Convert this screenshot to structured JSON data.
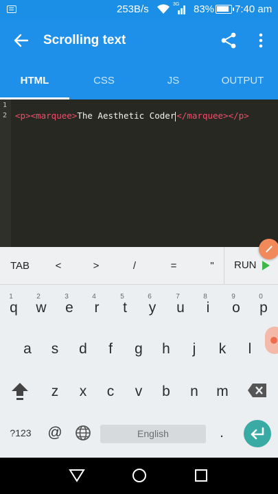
{
  "status_bar": {
    "network_speed": "253B/s",
    "signal_label": "3G",
    "battery_percent": "83%",
    "time": "7:40 am"
  },
  "app_bar": {
    "title": "Scrolling text"
  },
  "tabs": [
    {
      "label": "HTML",
      "active": true
    },
    {
      "label": "CSS",
      "active": false
    },
    {
      "label": "JS",
      "active": false
    },
    {
      "label": "OUTPUT",
      "active": false
    }
  ],
  "editor": {
    "line_numbers": [
      "1",
      "2"
    ],
    "line2": {
      "open_tags": "<p><marquee>",
      "text": "The Aesthetic Coder",
      "close_tags": "</marquee></p>"
    }
  },
  "shortcut_bar": {
    "keys": [
      "TAB",
      "<",
      ">",
      "/",
      "=",
      "\""
    ],
    "run_label": "RUN"
  },
  "keyboard": {
    "row1": [
      {
        "ch": "q",
        "num": "1"
      },
      {
        "ch": "w",
        "num": "2"
      },
      {
        "ch": "e",
        "num": "3"
      },
      {
        "ch": "r",
        "num": "4"
      },
      {
        "ch": "t",
        "num": "5"
      },
      {
        "ch": "y",
        "num": "6"
      },
      {
        "ch": "u",
        "num": "7"
      },
      {
        "ch": "i",
        "num": "8"
      },
      {
        "ch": "o",
        "num": "9"
      },
      {
        "ch": "p",
        "num": "0"
      }
    ],
    "row2": [
      "a",
      "s",
      "d",
      "f",
      "g",
      "h",
      "j",
      "k",
      "l"
    ],
    "row3": [
      "z",
      "x",
      "c",
      "v",
      "b",
      "n",
      "m"
    ],
    "symbols_label": "?123",
    "at_label": "@",
    "space_label": "English",
    "period_label": "."
  },
  "colors": {
    "primary": "#1e90ea",
    "editor_bg": "#272822",
    "tag": "#f44c6a",
    "run_play": "#41b64a",
    "enter": "#3aaaa5"
  }
}
